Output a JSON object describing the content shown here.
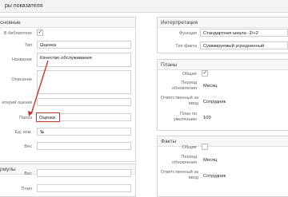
{
  "window": {
    "title": "ры показателя"
  },
  "basic": {
    "title": "сновные",
    "in_library_label": "В библиотеке",
    "type_label": "Тип",
    "type_value": "Оценка",
    "name_label": "Название",
    "name_value": "Качество обслуживания",
    "description_label": "Описание",
    "criterion_label": "итерий оценки",
    "folder_label": "Папка",
    "folder_value": "Оценки",
    "unit_label": "Ед. изм.",
    "unit_value": "%",
    "weight_label": "Вес"
  },
  "formulas": {
    "title": "рмулы",
    "weight_label": "Вес",
    "plan_label": "План"
  },
  "interpretation": {
    "title": "Интерпретация",
    "function_label": "Функция",
    "function_value": "Стандартная шкала -2/+2",
    "fact_type_label": "Тип факта",
    "fact_type_value": "Суммируемый усредненный"
  },
  "plans": {
    "title": "Планы",
    "common_label": "Общие",
    "period_label": "Период обновления",
    "period_value": "Месяц",
    "responsible_label": "Ответственный за ввод",
    "responsible_value": "Сотрудник",
    "default_label": "План по умолчанию",
    "default_value": "100"
  },
  "facts": {
    "title": "Факты",
    "common_label": "Общие",
    "period_label": "Период обновления",
    "period_value": "Месяц",
    "responsible_label": "Ответственный за ввод",
    "responsible_value": "Сотрудник"
  },
  "colors": {
    "highlight": "#c0392b",
    "accent_arrow": "#c0392b"
  }
}
